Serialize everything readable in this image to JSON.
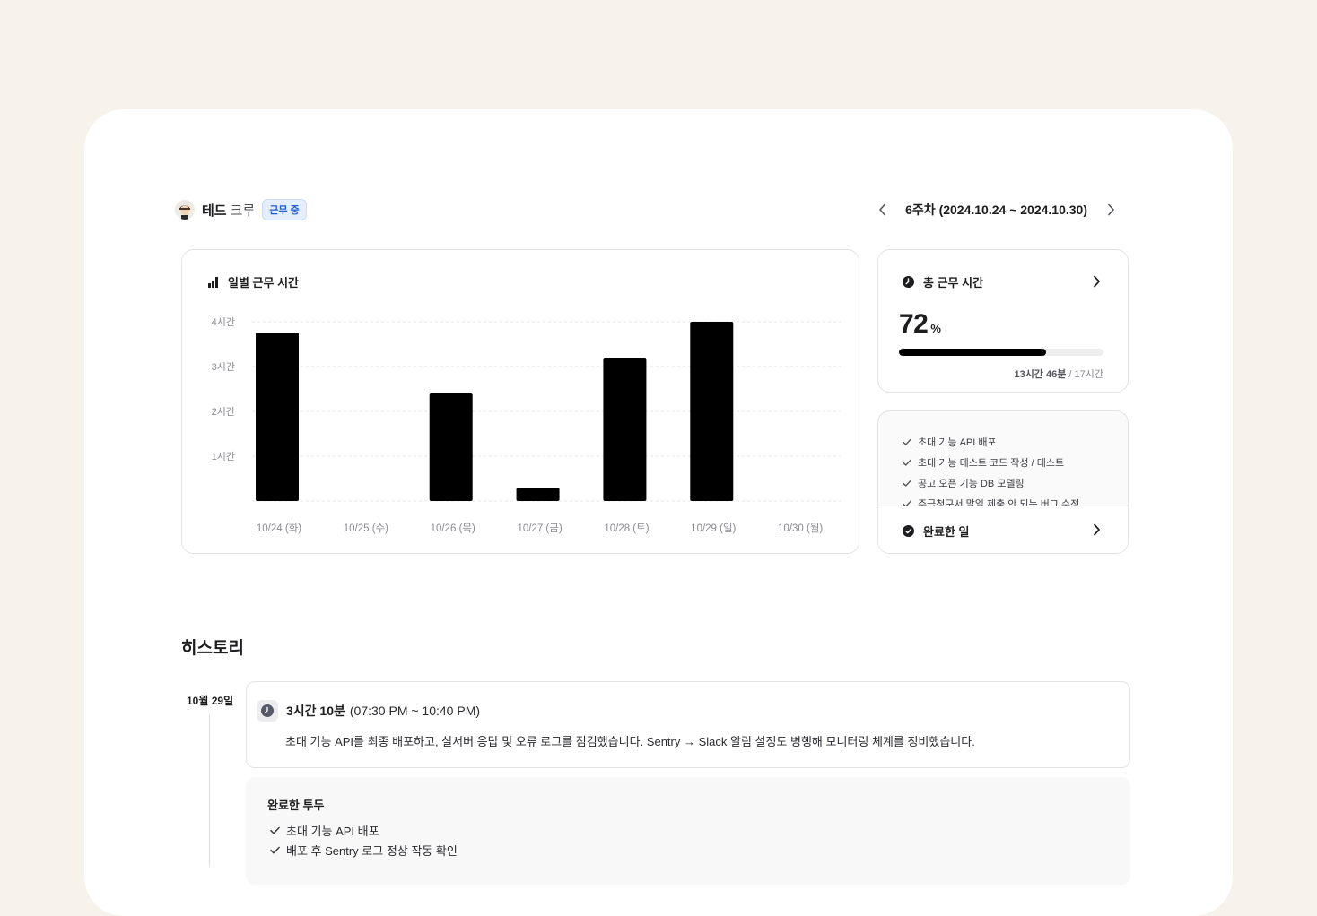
{
  "user": {
    "name": "테드",
    "role": "크루",
    "status_badge": "근무 중"
  },
  "week": {
    "label": "6주차 (2024.10.24 ~ 2024.10.30)"
  },
  "daily_panel": {
    "title": "일별 근무 시간"
  },
  "chart_data": {
    "type": "bar",
    "categories": [
      "10/24 (화)",
      "10/25 (수)",
      "10/26 (목)",
      "10/27 (금)",
      "10/28 (토)",
      "10/29 (일)",
      "10/30 (월)"
    ],
    "values": [
      3.76,
      0,
      2.4,
      0.3,
      3.2,
      4.0,
      0
    ],
    "y_ticks": [
      {
        "value": 4,
        "label": "4시간"
      },
      {
        "value": 3,
        "label": "3시간"
      },
      {
        "value": 2,
        "label": "2시간"
      },
      {
        "value": 1,
        "label": "1시간"
      }
    ],
    "ylim": [
      0,
      4
    ],
    "grid": true,
    "bar_color": "#000000",
    "grid_color": "#e6e6e9"
  },
  "total_panel": {
    "title": "총 근무 시간",
    "percent": 72,
    "percent_unit": "%",
    "worked": "13시간 46분",
    "goal": " / 17시간"
  },
  "done_panel": {
    "items": [
      "초대 기능 API 배포",
      "초대 기능 테스트 코드 작성 / 테스트",
      "공고 오픈 기능 DB 모델링",
      "주급청구서 말일 제출 안 되는 버그 수정"
    ],
    "footer_title": "완료한 일"
  },
  "history": {
    "title": "히스토리",
    "entries": [
      {
        "date": "10월 29일",
        "duration": "3시간 10분",
        "range": "(07:30 PM ~ 10:40 PM)",
        "description": "초대 기능 API를 최종 배포하고, 실서버 응답 및 오류 로그를 점검했습니다. Sentry → Slack 알림 설정도 병행해 모니터링 체계를 정비했습니다.",
        "todo_title": "완료한 투두",
        "todos": [
          "초대 기능 API 배포",
          "배포 후 Sentry 로그 정상 작동 확인"
        ]
      }
    ]
  }
}
